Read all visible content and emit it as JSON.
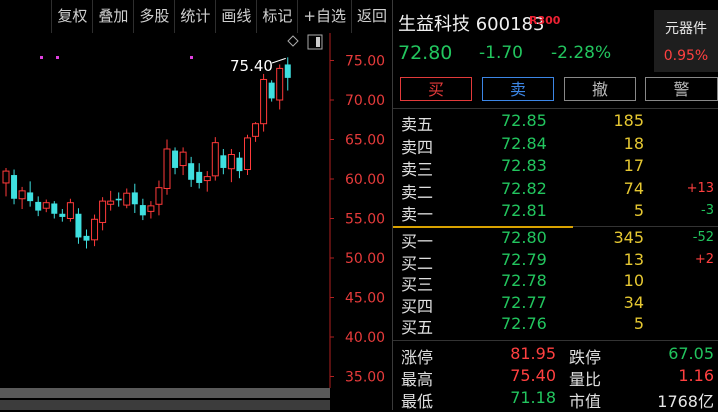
{
  "toolbar": [
    "复权",
    "叠加",
    "多股",
    "统计",
    "画线",
    "标记",
    "+自选",
    "返回"
  ],
  "chart": {
    "y_labels": [
      "75.00",
      "70.00",
      "65.00",
      "60.00",
      "55.00",
      "50.00",
      "45.00",
      "40.00",
      "35.00"
    ],
    "high_annotation": "75.40",
    "candles": [
      {
        "o": 59.5,
        "h": 61.4,
        "l": 57.8,
        "c": 61.0
      },
      {
        "o": 60.5,
        "h": 61.2,
        "l": 56.8,
        "c": 57.5
      },
      {
        "o": 57.5,
        "h": 59.0,
        "l": 56.2,
        "c": 58.5
      },
      {
        "o": 58.3,
        "h": 59.7,
        "l": 56.5,
        "c": 57.2
      },
      {
        "o": 57.1,
        "h": 57.8,
        "l": 55.3,
        "c": 56.0
      },
      {
        "o": 56.3,
        "h": 57.4,
        "l": 55.8,
        "c": 57.0
      },
      {
        "o": 56.9,
        "h": 57.2,
        "l": 55.0,
        "c": 55.6
      },
      {
        "o": 55.6,
        "h": 56.2,
        "l": 54.6,
        "c": 55.2
      },
      {
        "o": 55.0,
        "h": 57.5,
        "l": 54.6,
        "c": 57.0
      },
      {
        "o": 55.6,
        "h": 56.3,
        "l": 51.8,
        "c": 52.6
      },
      {
        "o": 52.8,
        "h": 53.6,
        "l": 51.2,
        "c": 52.2
      },
      {
        "o": 52.3,
        "h": 55.5,
        "l": 51.5,
        "c": 54.9
      },
      {
        "o": 54.5,
        "h": 57.7,
        "l": 53.5,
        "c": 57.2
      },
      {
        "o": 56.8,
        "h": 58.5,
        "l": 56.0,
        "c": 57.2
      },
      {
        "o": 57.5,
        "h": 58.3,
        "l": 56.5,
        "c": 57.3
      },
      {
        "o": 56.7,
        "h": 58.8,
        "l": 56.3,
        "c": 58.2
      },
      {
        "o": 58.3,
        "h": 59.4,
        "l": 55.7,
        "c": 56.8
      },
      {
        "o": 56.7,
        "h": 57.5,
        "l": 54.8,
        "c": 55.4
      },
      {
        "o": 55.9,
        "h": 57.2,
        "l": 55.0,
        "c": 56.6
      },
      {
        "o": 56.8,
        "h": 59.8,
        "l": 55.4,
        "c": 58.9
      },
      {
        "o": 58.8,
        "h": 65.0,
        "l": 58.0,
        "c": 63.8
      },
      {
        "o": 63.6,
        "h": 64.0,
        "l": 60.6,
        "c": 61.4
      },
      {
        "o": 61.7,
        "h": 64.0,
        "l": 60.5,
        "c": 63.4
      },
      {
        "o": 62.0,
        "h": 62.8,
        "l": 59.0,
        "c": 59.9
      },
      {
        "o": 60.9,
        "h": 62.0,
        "l": 58.8,
        "c": 59.5
      },
      {
        "o": 59.8,
        "h": 61.0,
        "l": 58.4,
        "c": 60.3
      },
      {
        "o": 60.4,
        "h": 65.3,
        "l": 59.8,
        "c": 64.6
      },
      {
        "o": 63.0,
        "h": 63.8,
        "l": 60.6,
        "c": 61.4
      },
      {
        "o": 61.3,
        "h": 63.8,
        "l": 59.6,
        "c": 63.1
      },
      {
        "o": 62.7,
        "h": 63.4,
        "l": 60.1,
        "c": 61.0
      },
      {
        "o": 61.2,
        "h": 65.6,
        "l": 60.5,
        "c": 65.2
      },
      {
        "o": 65.4,
        "h": 67.2,
        "l": 64.7,
        "c": 67.0
      },
      {
        "o": 67.0,
        "h": 73.3,
        "l": 66.0,
        "c": 72.6
      },
      {
        "o": 72.2,
        "h": 72.5,
        "l": 69.8,
        "c": 70.2
      },
      {
        "o": 70.0,
        "h": 74.5,
        "l": 68.8,
        "c": 74.0
      },
      {
        "o": 74.5,
        "h": 75.4,
        "l": 71.2,
        "c": 72.8
      }
    ]
  },
  "stock": {
    "name": "生益科技",
    "code": "600183",
    "badge": "R300",
    "price": "72.80",
    "change": "-1.70",
    "change_pct": "-2.28%"
  },
  "sector": {
    "name": "元器件",
    "pct": "0.95%"
  },
  "trade": {
    "buy": "买",
    "sell": "卖",
    "cancel": "撤",
    "alert": "警"
  },
  "asks": [
    {
      "label": "卖五",
      "price": "72.85",
      "vol": "185",
      "delta": ""
    },
    {
      "label": "卖四",
      "price": "72.84",
      "vol": "18",
      "delta": ""
    },
    {
      "label": "卖三",
      "price": "72.83",
      "vol": "17",
      "delta": ""
    },
    {
      "label": "卖二",
      "price": "72.82",
      "vol": "74",
      "delta": "+13"
    },
    {
      "label": "卖一",
      "price": "72.81",
      "vol": "5",
      "delta": "-3"
    }
  ],
  "bids": [
    {
      "label": "买一",
      "price": "72.80",
      "vol": "345",
      "delta": "-52"
    },
    {
      "label": "买二",
      "price": "72.79",
      "vol": "13",
      "delta": "+2"
    },
    {
      "label": "买三",
      "price": "72.78",
      "vol": "10",
      "delta": ""
    },
    {
      "label": "买四",
      "price": "72.77",
      "vol": "34",
      "delta": ""
    },
    {
      "label": "买五",
      "price": "72.76",
      "vol": "5",
      "delta": ""
    }
  ],
  "stats": [
    {
      "l1": "涨停",
      "v1": "81.95",
      "l2": "跌停",
      "v2": "67.05"
    },
    {
      "l1": "最高",
      "v1": "75.40",
      "l2": "量比",
      "v2": "1.16"
    },
    {
      "l1": "最低",
      "v1": "71.18",
      "l2": "市值",
      "v2": "1768亿"
    }
  ],
  "colors": {
    "up": "#ff4040",
    "down": "#22c55e",
    "axis": "#e63b3b",
    "volume": "#e6c832"
  }
}
